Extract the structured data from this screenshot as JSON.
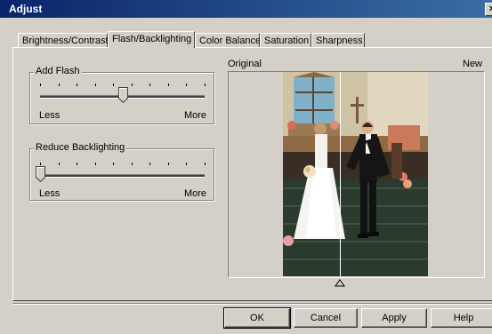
{
  "window": {
    "title": "Adjust"
  },
  "tabs": [
    {
      "label": "Brightness/Contrast",
      "active": false
    },
    {
      "label": "Flash/Backlighting",
      "active": true
    },
    {
      "label": "Color Balance",
      "active": false
    },
    {
      "label": "Saturation",
      "active": false
    },
    {
      "label": "Sharpness",
      "active": false
    }
  ],
  "add_flash": {
    "title": "Add Flash",
    "min_label": "Less",
    "max_label": "More",
    "level": 0.5
  },
  "reduce_backlighting": {
    "title": "Reduce Backlighting",
    "min_label": "Less",
    "max_label": "More",
    "level": 0.0
  },
  "preview": {
    "original_label": "Original",
    "new_label": "New"
  },
  "buttons": {
    "ok": "OK",
    "cancel": "Cancel",
    "apply": "Apply",
    "help": "Help"
  },
  "colors": {
    "titlebar_start": "#0a246a",
    "titlebar_end": "#3a6ea5",
    "dialog_bg": "#d4d0c8"
  }
}
